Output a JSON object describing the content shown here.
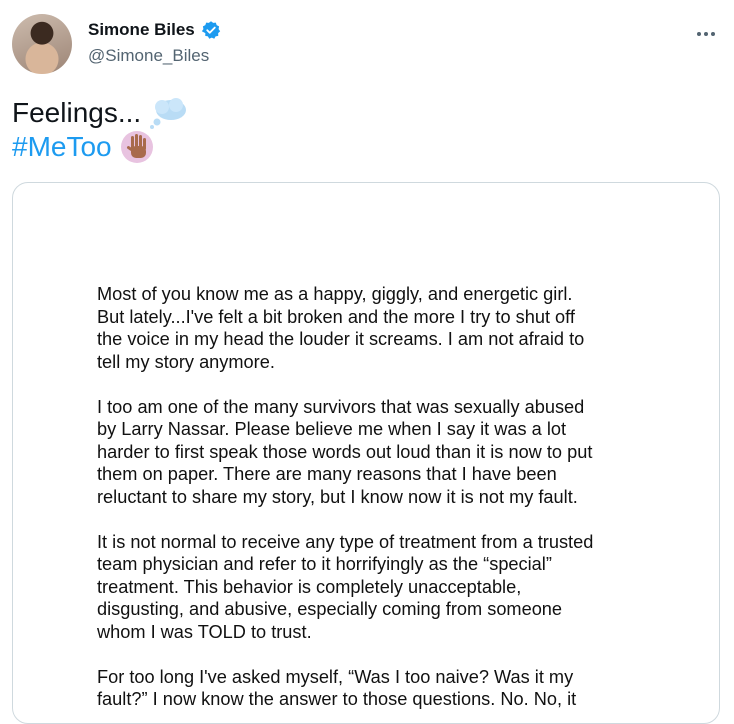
{
  "author": {
    "display_name": "Simone Biles",
    "handle": "@Simone_Biles",
    "verified_icon": "verified-badge-icon",
    "avatar_icon": "profile-avatar"
  },
  "menu_icon": "more-options-icon",
  "tweet": {
    "line1": "Feelings...",
    "line1_emoji": "thought-balloon-emoji",
    "hashtag": "#MeToo",
    "line2_emoji": "raised-hand-emoji"
  },
  "document": {
    "paragraphs": [
      "Most of you know me as a happy, giggly, and energetic girl.\nBut lately...I've felt a bit broken and the more I try to shut off\nthe voice in my head the louder it screams.  I am not afraid to\ntell my story anymore.",
      "I too am one of the many survivors that was sexually abused\nby Larry Nassar. Please believe me when I say it was a lot\nharder to first speak those words out loud than it is now to put\nthem on paper. There are many reasons that I have been\nreluctant to share my story, but I know now it is not my fault.",
      "It is not normal to receive any type of treatment from a trusted\nteam physician and refer to it horrifyingly as the “special”\ntreatment. This behavior is completely unacceptable,\ndisgusting, and abusive, especially coming from someone\nwhom I was TOLD to trust.",
      "For too long I've asked myself, “Was I too naive? Was it my\nfault?” I now know the answer to those questions.  No.  No, it"
    ]
  },
  "colors": {
    "hashtag": "#1d9bf0",
    "verified": "#1d9bf0",
    "secondary_text": "#536471",
    "border": "#cfd9de"
  }
}
